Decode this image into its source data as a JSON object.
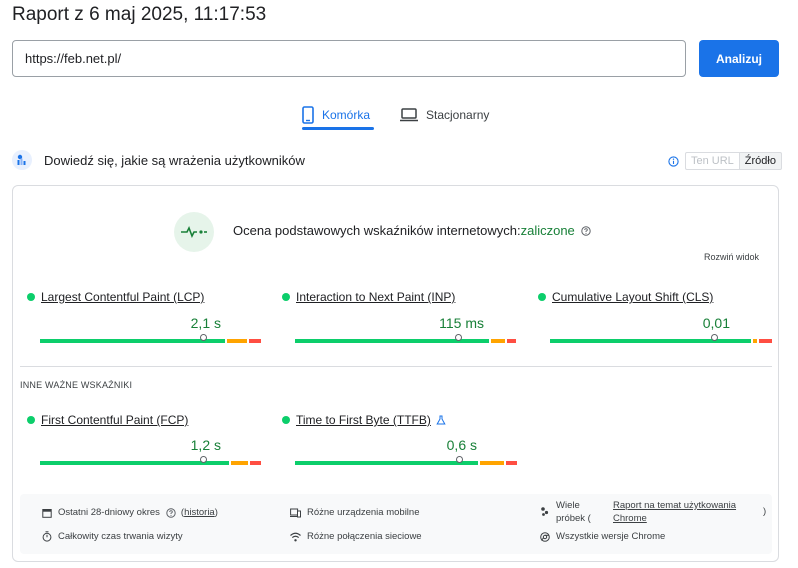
{
  "report": {
    "title": "Raport z 6 maj 2025, 11:17:53"
  },
  "search": {
    "url_value": "https://feb.net.pl/",
    "analyze_label": "Analizuj"
  },
  "tabs": [
    {
      "label": "Komórka",
      "icon": "smartphone-icon",
      "active": true
    },
    {
      "label": "Stacjonarny",
      "icon": "laptop-icon",
      "active": false
    }
  ],
  "section": {
    "title": "Dowiedź się, jakie są wrażenia użytkowników",
    "icon": "crux-users-icon",
    "toggle": {
      "url_label": "Ten URL",
      "origin_label": "Źródło",
      "selected": "Źródło"
    }
  },
  "assessment": {
    "label": "Ocena podstawowych wskaźników internetowych:",
    "status": "zaliczone",
    "expand_label": "Rozwiń widok"
  },
  "core_metrics": [
    {
      "name": "Largest Contentful Paint (LCP)",
      "value": "2,1 s",
      "good": 0.76,
      "ni": 0.08,
      "poor": 0.05,
      "marker": 0.75
    },
    {
      "name": "Interaction to Next Paint (INP)",
      "value": "115 ms",
      "good": 0.86,
      "ni": 0.06,
      "poor": 0.04,
      "marker": 0.75
    },
    {
      "name": "Cumulative Layout Shift (CLS)",
      "value": "0,01",
      "good": 0.92,
      "ni": 0.02,
      "poor": 0.06,
      "marker": 0.75
    }
  ],
  "other": {
    "label": "INNE WAŻNE WSKAŹNIKI",
    "metrics": [
      {
        "name": "First Contentful Paint (FCP)",
        "value": "1,2 s",
        "good": 0.86,
        "ni": 0.08,
        "poor": 0.05,
        "marker": 0.75
      },
      {
        "name": "Time to First Byte (TTFB)",
        "value": "0,6 s",
        "good": 0.83,
        "ni": 0.11,
        "poor": 0.05,
        "marker": 0.75,
        "experimental_icon": "flask-icon"
      }
    ]
  },
  "footer": {
    "period": "Ostatni 28-dniowy okres",
    "history": "historia",
    "devices": "Różne urządzenia mobilne",
    "samples": "Wiele próbek (",
    "crux_report": "Raport na temat użytkowania Chrome",
    "close_paren": ")",
    "duration": "Całkowity czas trwania wizyty",
    "network": "Różne połączenia sieciowe",
    "chrome_versions": "Wszystkie wersje Chrome"
  },
  "colors": {
    "accent": "#1a73e8",
    "good": "#0cce6b",
    "ni": "#ffa400",
    "poor": "#ff4e42",
    "pass_text": "#188038"
  }
}
